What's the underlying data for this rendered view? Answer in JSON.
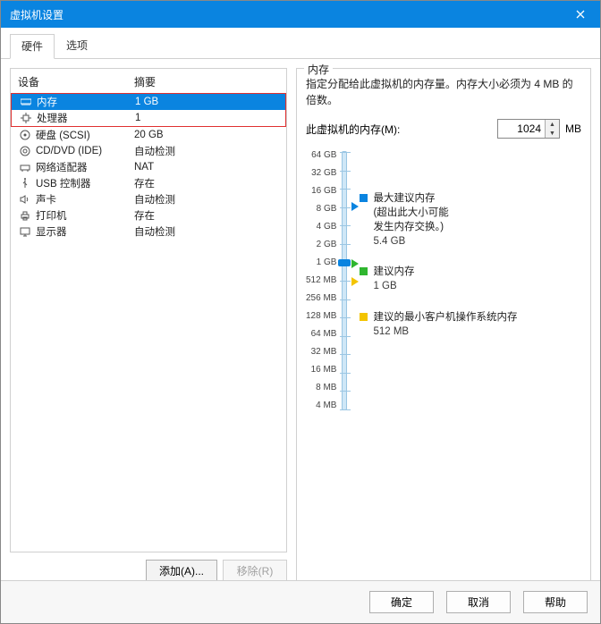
{
  "window": {
    "title": "虚拟机设置",
    "close_aria": "关闭"
  },
  "tabs": {
    "hardware": "硬件",
    "options": "选项"
  },
  "dev_head": {
    "device": "设备",
    "summary": "摘要"
  },
  "devices": [
    {
      "icon": "memory-icon",
      "name": "内存",
      "summary": "1 GB",
      "sel": true
    },
    {
      "icon": "cpu-icon",
      "name": "处理器",
      "summary": "1",
      "sel": false
    },
    {
      "icon": "disk-icon",
      "name": "硬盘 (SCSI)",
      "summary": "20 GB",
      "sel": false
    },
    {
      "icon": "cd-icon",
      "name": "CD/DVD (IDE)",
      "summary": "自动检测",
      "sel": false
    },
    {
      "icon": "net-icon",
      "name": "网络适配器",
      "summary": "NAT",
      "sel": false
    },
    {
      "icon": "usb-icon",
      "name": "USB 控制器",
      "summary": "存在",
      "sel": false
    },
    {
      "icon": "sound-icon",
      "name": "声卡",
      "summary": "自动检测",
      "sel": false
    },
    {
      "icon": "printer-icon",
      "name": "打印机",
      "summary": "存在",
      "sel": false
    },
    {
      "icon": "display-icon",
      "name": "显示器",
      "summary": "自动检测",
      "sel": false
    }
  ],
  "buttons": {
    "add": "添加(A)...",
    "remove": "移除(R)",
    "ok": "确定",
    "cancel": "取消",
    "help": "帮助"
  },
  "mem": {
    "group_title": "内存",
    "desc": "指定分配给此虚拟机的内存量。内存大小必须为 4 MB 的倍数。",
    "label": "此虚拟机的内存(M):",
    "value": "1024",
    "unit": "MB",
    "scale_ticks": [
      "64 GB",
      "32 GB",
      "16 GB",
      "8 GB",
      "4 GB",
      "2 GB",
      "1 GB",
      "512 MB",
      "256 MB",
      "128 MB",
      "64 MB",
      "32 MB",
      "16 MB",
      "8 MB",
      "4 MB"
    ],
    "scale_positions": {
      "max_pct": 21,
      "current_pct": 43,
      "rec_pct": 43,
      "min_pct": 50
    },
    "legend": {
      "max_l1": "最大建议内存",
      "max_l2": "(超出此大小可能",
      "max_l3": "发生内存交换。)",
      "max_val": "5.4 GB",
      "rec_l1": "建议内存",
      "rec_val": "1 GB",
      "min_l1": "建议的最小客户机操作系统内存",
      "min_val": "512 MB"
    }
  }
}
